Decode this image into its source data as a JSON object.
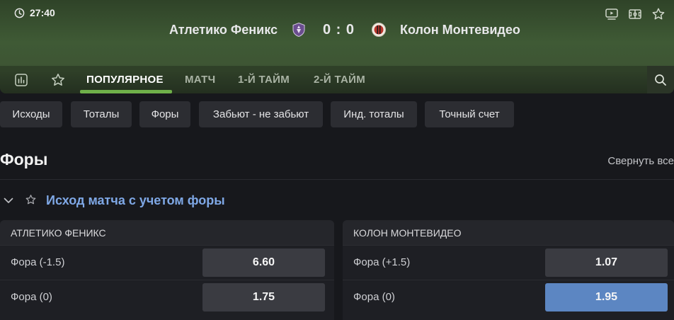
{
  "match": {
    "timer": "27:40",
    "team_home": "Атлетико Феникс",
    "team_away": "Колон Монтевидео",
    "score": "0 : 0"
  },
  "icons": {
    "timer": "clock-icon",
    "video": "video-icon",
    "field": "field-icon",
    "favorite": "star-icon",
    "stats": "stats-icon",
    "search": "search-icon",
    "collapse": "chevron-down-icon"
  },
  "tabs": [
    {
      "label": "ПОПУЛЯРНОЕ",
      "active": true
    },
    {
      "label": "МАТЧ",
      "active": false
    },
    {
      "label": "1-Й ТАЙМ",
      "active": false
    },
    {
      "label": "2-Й ТАЙМ",
      "active": false
    }
  ],
  "chips": [
    "Исходы",
    "Тоталы",
    "Форы",
    "Забьют - не забьют",
    "Инд. тоталы",
    "Точный счет"
  ],
  "section": {
    "title": "Форы",
    "collapse_label": "Свернуть все"
  },
  "market": {
    "title": "Исход матча с учетом форы",
    "columns": [
      {
        "header": "АТЛЕТИКО ФЕНИКС",
        "rows": [
          {
            "label": "Фора (-1.5)",
            "odd": "6.60",
            "selected": false
          },
          {
            "label": "Фора (0)",
            "odd": "1.75",
            "selected": false
          }
        ]
      },
      {
        "header": "КОЛОН МОНТЕВИДЕО",
        "rows": [
          {
            "label": "Фора (+1.5)",
            "odd": "1.07",
            "selected": false
          },
          {
            "label": "Фора (0)",
            "odd": "1.95",
            "selected": true
          }
        ]
      }
    ]
  },
  "colors": {
    "accent_green": "#6fb04a",
    "market_title": "#7fa8e6",
    "selected_odd": "#5c86c2"
  }
}
